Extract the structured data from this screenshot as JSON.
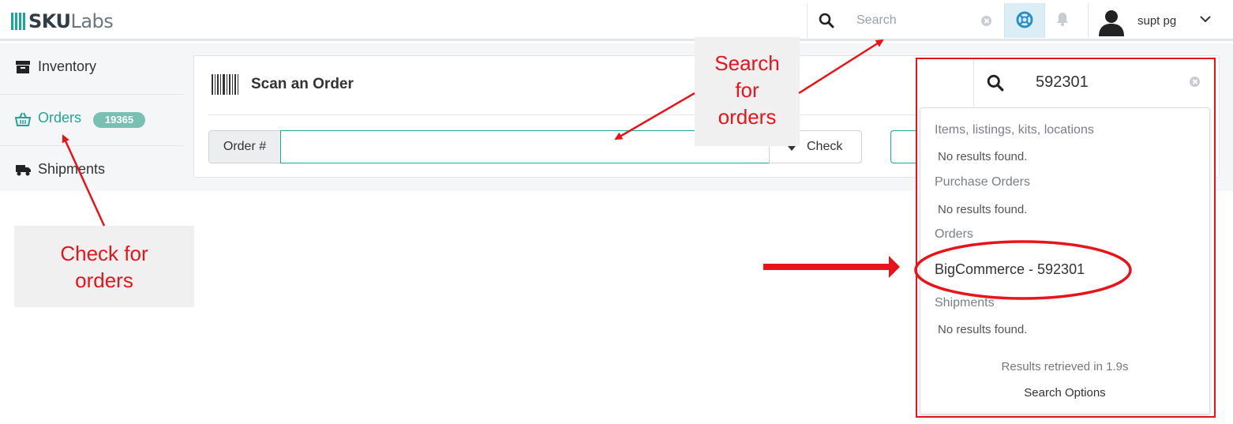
{
  "app": {
    "logo_text_bold": "SKU",
    "logo_text_light": "Labs",
    "accent_color": "#21a799"
  },
  "header": {
    "search_placeholder": "Search",
    "user_name": "supt pg",
    "icons": [
      "search-icon",
      "clear-icon",
      "lifebuoy-icon",
      "bell-icon",
      "user-avatar-icon",
      "chevron-down-icon"
    ]
  },
  "sidebar": {
    "items": [
      {
        "label": "Inventory",
        "icon": "archive-box-icon"
      },
      {
        "label": "Orders",
        "icon": "basket-icon",
        "badge": "19365",
        "active": true
      },
      {
        "label": "Shipments",
        "icon": "truck-icon"
      }
    ]
  },
  "scan_card": {
    "title": "Scan an Order",
    "order_addon": "Order #",
    "order_value": "",
    "check_label": "Check"
  },
  "search_dropdown": {
    "query": "592301",
    "sections": [
      {
        "heading": "Items, listings, kits, locations",
        "empty": "No results found."
      },
      {
        "heading": "Purchase Orders",
        "empty": "No results found."
      },
      {
        "heading": "Orders",
        "result": "BigCommerce - 592301"
      },
      {
        "heading": "Shipments",
        "empty": "No results found."
      }
    ],
    "timing": "Results retrieved in 1.9s",
    "options_label": "Search Options"
  },
  "annotations": {
    "search_callout": [
      "Search",
      "for",
      "orders"
    ],
    "check_callout": [
      "Check for",
      "orders"
    ],
    "color": "#e8141c"
  }
}
